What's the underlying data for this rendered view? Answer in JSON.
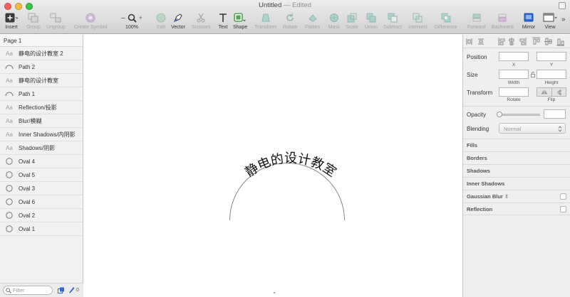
{
  "window": {
    "title": "Untitled",
    "title_suffix": "— Edited"
  },
  "toolbar": {
    "insert": "Insert",
    "group": "Group",
    "ungroup": "Ungroup",
    "create_symbol": "Create Symbol",
    "zoom_value": "100%",
    "zoom_minus": "–",
    "zoom_plus": "+",
    "edit": "Edit",
    "vector": "Vector",
    "scissors": "Scissors",
    "text": "Text",
    "shape": "Shape",
    "transform": "Transform",
    "rotate": "Rotate",
    "flatten": "Flatten",
    "mask": "Mask",
    "scale": "Scale",
    "union": "Union",
    "subtract": "Subtract",
    "intersect": "Intersect",
    "difference": "Difference",
    "forward": "Forward",
    "backward": "Backward",
    "mirror": "Mirror",
    "view": "View",
    "overflow": "»"
  },
  "left_panel": {
    "page_label": "Page 1",
    "layers": [
      {
        "icon": "text",
        "icon_text": "Aa",
        "name": "静电的设计教室 2"
      },
      {
        "icon": "path",
        "icon_text": "",
        "name": "Path 2"
      },
      {
        "icon": "text",
        "icon_text": "Aa",
        "name": "静电的设计教室"
      },
      {
        "icon": "path",
        "icon_text": "",
        "name": "Path 1"
      },
      {
        "icon": "text",
        "icon_text": "Aa",
        "name": "Reflection/投影"
      },
      {
        "icon": "text",
        "icon_text": "Aa",
        "name": "Blur/模糊"
      },
      {
        "icon": "text",
        "icon_text": "Aa",
        "name": "Inner Shadows/内阴影"
      },
      {
        "icon": "text",
        "icon_text": "Aa",
        "name": "Shadows/阴影"
      },
      {
        "icon": "oval",
        "icon_text": "",
        "name": "Oval 4"
      },
      {
        "icon": "oval",
        "icon_text": "",
        "name": "Oval 5"
      },
      {
        "icon": "oval",
        "icon_text": "",
        "name": "Oval 3"
      },
      {
        "icon": "oval",
        "icon_text": "",
        "name": "Oval 6"
      },
      {
        "icon": "oval",
        "icon_text": "",
        "name": "Oval 2"
      },
      {
        "icon": "oval",
        "icon_text": "",
        "name": "Oval 1"
      }
    ],
    "filter_placeholder": "Filter",
    "slice_count": "0"
  },
  "canvas": {
    "arc_text": "静电的设计教室"
  },
  "inspector": {
    "position_label": "Position",
    "x_caption": "X",
    "y_caption": "Y",
    "size_label": "Size",
    "width_caption": "Width",
    "height_caption": "Height",
    "transform_label": "Transform",
    "rotate_caption": "Rotate",
    "flip_caption": "Flip",
    "opacity_label": "Opacity",
    "opacity_value": 0,
    "blending_label": "Blending",
    "blending_value": "Normal",
    "sections": {
      "fills": "Fills",
      "borders": "Borders",
      "shadows": "Shadows",
      "inner_shadows": "Inner Shadows",
      "gaussian_blur": "Gaussian Blur",
      "gaussian_blur_arrows": "⇕",
      "reflection": "Reflection"
    }
  },
  "colors": {
    "mirror_icon": "#2a6bd3",
    "vector_pen": "#2d7be0",
    "shape_square": "#4aa94a",
    "disabled_icon": "#6fc7b6"
  }
}
